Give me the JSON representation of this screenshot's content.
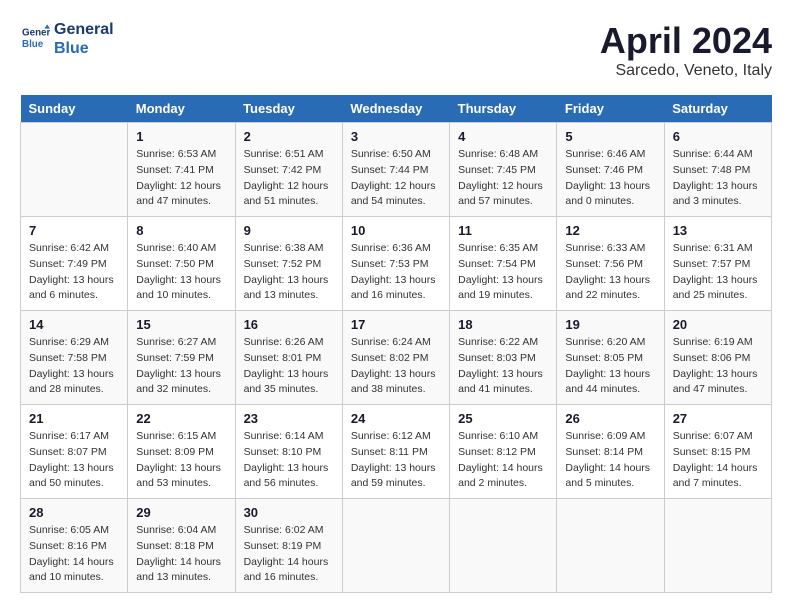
{
  "header": {
    "logo_line1": "General",
    "logo_line2": "Blue",
    "month": "April 2024",
    "location": "Sarcedo, Veneto, Italy"
  },
  "days_of_week": [
    "Sunday",
    "Monday",
    "Tuesday",
    "Wednesday",
    "Thursday",
    "Friday",
    "Saturday"
  ],
  "weeks": [
    [
      {
        "day": "",
        "info": ""
      },
      {
        "day": "1",
        "info": "Sunrise: 6:53 AM\nSunset: 7:41 PM\nDaylight: 12 hours\nand 47 minutes."
      },
      {
        "day": "2",
        "info": "Sunrise: 6:51 AM\nSunset: 7:42 PM\nDaylight: 12 hours\nand 51 minutes."
      },
      {
        "day": "3",
        "info": "Sunrise: 6:50 AM\nSunset: 7:44 PM\nDaylight: 12 hours\nand 54 minutes."
      },
      {
        "day": "4",
        "info": "Sunrise: 6:48 AM\nSunset: 7:45 PM\nDaylight: 12 hours\nand 57 minutes."
      },
      {
        "day": "5",
        "info": "Sunrise: 6:46 AM\nSunset: 7:46 PM\nDaylight: 13 hours\nand 0 minutes."
      },
      {
        "day": "6",
        "info": "Sunrise: 6:44 AM\nSunset: 7:48 PM\nDaylight: 13 hours\nand 3 minutes."
      }
    ],
    [
      {
        "day": "7",
        "info": "Sunrise: 6:42 AM\nSunset: 7:49 PM\nDaylight: 13 hours\nand 6 minutes."
      },
      {
        "day": "8",
        "info": "Sunrise: 6:40 AM\nSunset: 7:50 PM\nDaylight: 13 hours\nand 10 minutes."
      },
      {
        "day": "9",
        "info": "Sunrise: 6:38 AM\nSunset: 7:52 PM\nDaylight: 13 hours\nand 13 minutes."
      },
      {
        "day": "10",
        "info": "Sunrise: 6:36 AM\nSunset: 7:53 PM\nDaylight: 13 hours\nand 16 minutes."
      },
      {
        "day": "11",
        "info": "Sunrise: 6:35 AM\nSunset: 7:54 PM\nDaylight: 13 hours\nand 19 minutes."
      },
      {
        "day": "12",
        "info": "Sunrise: 6:33 AM\nSunset: 7:56 PM\nDaylight: 13 hours\nand 22 minutes."
      },
      {
        "day": "13",
        "info": "Sunrise: 6:31 AM\nSunset: 7:57 PM\nDaylight: 13 hours\nand 25 minutes."
      }
    ],
    [
      {
        "day": "14",
        "info": "Sunrise: 6:29 AM\nSunset: 7:58 PM\nDaylight: 13 hours\nand 28 minutes."
      },
      {
        "day": "15",
        "info": "Sunrise: 6:27 AM\nSunset: 7:59 PM\nDaylight: 13 hours\nand 32 minutes."
      },
      {
        "day": "16",
        "info": "Sunrise: 6:26 AM\nSunset: 8:01 PM\nDaylight: 13 hours\nand 35 minutes."
      },
      {
        "day": "17",
        "info": "Sunrise: 6:24 AM\nSunset: 8:02 PM\nDaylight: 13 hours\nand 38 minutes."
      },
      {
        "day": "18",
        "info": "Sunrise: 6:22 AM\nSunset: 8:03 PM\nDaylight: 13 hours\nand 41 minutes."
      },
      {
        "day": "19",
        "info": "Sunrise: 6:20 AM\nSunset: 8:05 PM\nDaylight: 13 hours\nand 44 minutes."
      },
      {
        "day": "20",
        "info": "Sunrise: 6:19 AM\nSunset: 8:06 PM\nDaylight: 13 hours\nand 47 minutes."
      }
    ],
    [
      {
        "day": "21",
        "info": "Sunrise: 6:17 AM\nSunset: 8:07 PM\nDaylight: 13 hours\nand 50 minutes."
      },
      {
        "day": "22",
        "info": "Sunrise: 6:15 AM\nSunset: 8:09 PM\nDaylight: 13 hours\nand 53 minutes."
      },
      {
        "day": "23",
        "info": "Sunrise: 6:14 AM\nSunset: 8:10 PM\nDaylight: 13 hours\nand 56 minutes."
      },
      {
        "day": "24",
        "info": "Sunrise: 6:12 AM\nSunset: 8:11 PM\nDaylight: 13 hours\nand 59 minutes."
      },
      {
        "day": "25",
        "info": "Sunrise: 6:10 AM\nSunset: 8:12 PM\nDaylight: 14 hours\nand 2 minutes."
      },
      {
        "day": "26",
        "info": "Sunrise: 6:09 AM\nSunset: 8:14 PM\nDaylight: 14 hours\nand 5 minutes."
      },
      {
        "day": "27",
        "info": "Sunrise: 6:07 AM\nSunset: 8:15 PM\nDaylight: 14 hours\nand 7 minutes."
      }
    ],
    [
      {
        "day": "28",
        "info": "Sunrise: 6:05 AM\nSunset: 8:16 PM\nDaylight: 14 hours\nand 10 minutes."
      },
      {
        "day": "29",
        "info": "Sunrise: 6:04 AM\nSunset: 8:18 PM\nDaylight: 14 hours\nand 13 minutes."
      },
      {
        "day": "30",
        "info": "Sunrise: 6:02 AM\nSunset: 8:19 PM\nDaylight: 14 hours\nand 16 minutes."
      },
      {
        "day": "",
        "info": ""
      },
      {
        "day": "",
        "info": ""
      },
      {
        "day": "",
        "info": ""
      },
      {
        "day": "",
        "info": ""
      }
    ]
  ]
}
